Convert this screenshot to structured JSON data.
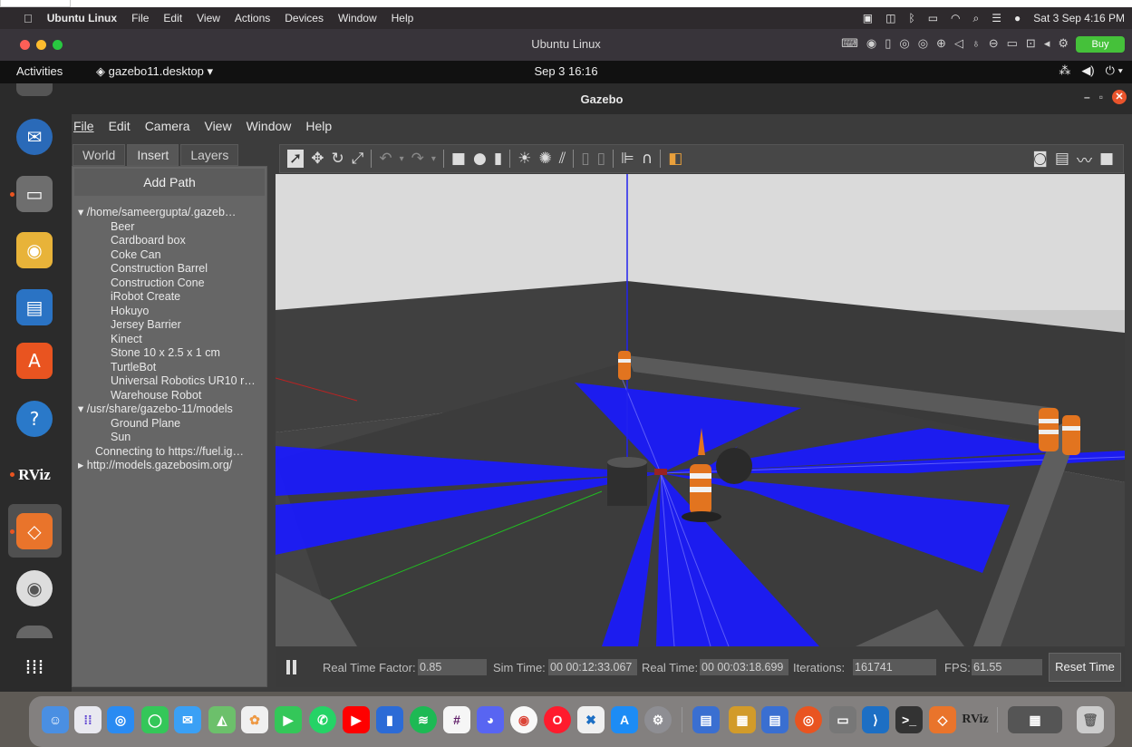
{
  "mac_menubar": {
    "apple": "",
    "app": "Ubuntu Linux",
    "menus": [
      "File",
      "Edit",
      "View",
      "Actions",
      "Devices",
      "Window",
      "Help"
    ],
    "datetime": "Sat 3 Sep  4:16 PM"
  },
  "vm": {
    "title": "Ubuntu Linux",
    "buy": "Buy"
  },
  "ubuntu_topbar": {
    "activities": "Activities",
    "app_menu": "gazebo11.desktop ▾",
    "clock": "Sep 3  16:16"
  },
  "gazebo": {
    "title": "Gazebo",
    "menus": [
      "File",
      "Edit",
      "Camera",
      "View",
      "Window",
      "Help"
    ],
    "tabs": [
      "World",
      "Insert",
      "Layers"
    ],
    "active_tab": "Insert",
    "add_path": "Add Path",
    "tree": {
      "local_path": "/home/sameergupta/.gazeb…",
      "local_models": [
        "Beer",
        "Cardboard box",
        "Coke Can",
        "Construction Barrel",
        "Construction Cone",
        "iRobot Create",
        "Hokuyo",
        "Jersey Barrier",
        "Kinect",
        "Stone 10 x 2.5 x 1 cm",
        "TurtleBot",
        "Universal Robotics UR10 r…",
        "Warehouse Robot"
      ],
      "share_path": "/usr/share/gazebo-11/models",
      "share_models": [
        "Ground Plane",
        "Sun"
      ],
      "connecting": "Connecting to https://fuel.ig…",
      "remote": "http://models.gazebosim.org/"
    },
    "status": {
      "rtf_label": "Real Time Factor:",
      "rtf": "0.85",
      "sim_label": "Sim Time:",
      "sim": "00 00:12:33.067",
      "real_label": "Real Time:",
      "real": "00 00:03:18.699",
      "iter_label": "Iterations:",
      "iter": "161741",
      "fps_label": "FPS:",
      "fps": "61.55",
      "reset": "Reset Time"
    }
  },
  "dock_labels": {
    "rviz": "RViz"
  },
  "colors": {
    "laser": "#1a1aff",
    "accent": "#e95420",
    "buy": "#45c13a"
  }
}
